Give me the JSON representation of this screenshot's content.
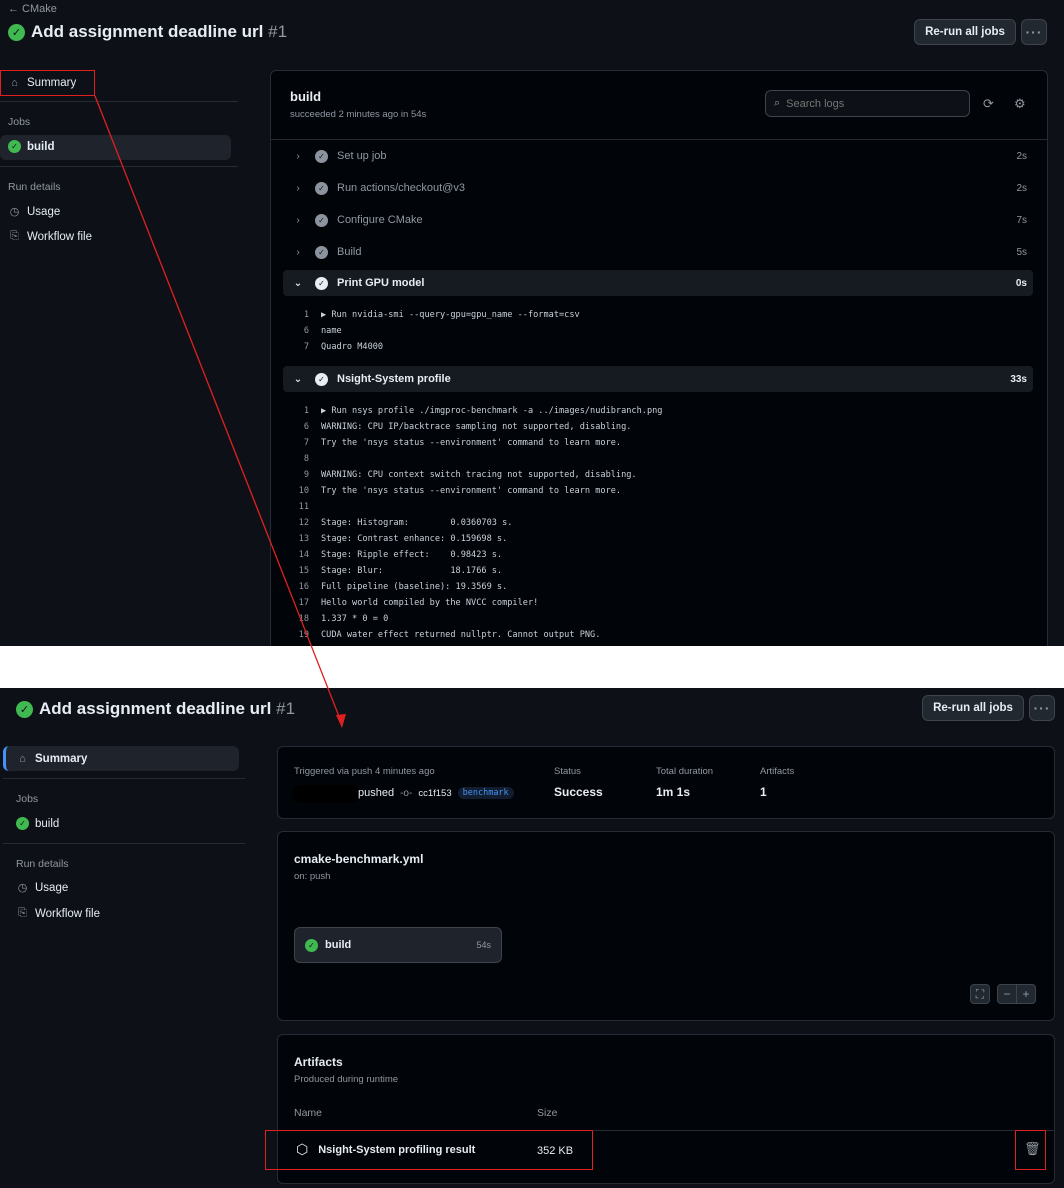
{
  "top": {
    "back_label": "← CMake",
    "title": "Add assignment deadline url",
    "run_number": "#1",
    "rerun_label": "Re-run all jobs",
    "more_label": "···",
    "sidebar": {
      "summary": "Summary",
      "jobs_heading": "Jobs",
      "build": "build",
      "run_details_heading": "Run details",
      "usage": "Usage",
      "workflow_file": "Workflow file"
    },
    "log": {
      "title": "build",
      "subtitle": "succeeded 2 minutes ago in 54s",
      "search_placeholder": "Search logs",
      "steps": [
        {
          "name": "Set up job",
          "duration": "2s"
        },
        {
          "name": "Run actions/checkout@v3",
          "duration": "2s"
        },
        {
          "name": "Configure CMake",
          "duration": "7s"
        },
        {
          "name": "Build",
          "duration": "5s"
        }
      ],
      "gpu_step": {
        "name": "Print GPU model",
        "duration": "0s"
      },
      "gpu_lines": [
        {
          "n": "1",
          "t": "▶ Run nvidia-smi --query-gpu=gpu_name --format=csv"
        },
        {
          "n": "6",
          "t": "name"
        },
        {
          "n": "7",
          "t": "Quadro M4000"
        }
      ],
      "nsight_step": {
        "name": "Nsight-System profile",
        "duration": "33s"
      },
      "nsight_lines": [
        {
          "n": "1",
          "t": "▶ Run nsys profile ./imgproc-benchmark -a ../images/nudibranch.png"
        },
        {
          "n": "6",
          "t": "WARNING: CPU IP/backtrace sampling not supported, disabling."
        },
        {
          "n": "7",
          "t": "Try the 'nsys status --environment' command to learn more."
        },
        {
          "n": "8",
          "t": ""
        },
        {
          "n": "9",
          "t": "WARNING: CPU context switch tracing not supported, disabling."
        },
        {
          "n": "10",
          "t": "Try the 'nsys status --environment' command to learn more."
        },
        {
          "n": "11",
          "t": ""
        },
        {
          "n": "12",
          "t": "Stage: Histogram:        0.0360703 s."
        },
        {
          "n": "13",
          "t": "Stage: Contrast enhance: 0.159698 s."
        },
        {
          "n": "14",
          "t": "Stage: Ripple effect:    0.98423 s."
        },
        {
          "n": "15",
          "t": "Stage: Blur:             18.1766 s."
        },
        {
          "n": "16",
          "t": "Full pipeline (baseline): 19.3569 s."
        },
        {
          "n": "17",
          "t": "Hello world compiled by the NVCC compiler!"
        },
        {
          "n": "18",
          "t": "1.337 * 0 = 0"
        },
        {
          "n": "19",
          "t": "CUDA water effect returned nullptr. Cannot output PNG."
        }
      ]
    }
  },
  "bottom": {
    "title": "Add assignment deadline url",
    "run_number": "#1",
    "rerun_label": "Re-run all jobs",
    "more_label": "···",
    "sidebar": {
      "summary": "Summary",
      "jobs_heading": "Jobs",
      "build": "build",
      "run_details_heading": "Run details",
      "usage": "Usage",
      "workflow_file": "Workflow file"
    },
    "summary_card": {
      "triggered": "Triggered via push 4 minutes ago",
      "pushed": "pushed",
      "commit": "cc1f153",
      "branch": "benchmark",
      "status_label": "Status",
      "status_value": "Success",
      "duration_label": "Total duration",
      "duration_value": "1m 1s",
      "artifacts_label": "Artifacts",
      "artifacts_value": "1"
    },
    "workflow_card": {
      "file": "cmake-benchmark.yml",
      "trigger": "on: push",
      "job_name": "build",
      "job_duration": "54s",
      "zoom_out": "−",
      "zoom_in": "+"
    },
    "artifacts_card": {
      "title": "Artifacts",
      "subtitle": "Produced during runtime",
      "col_name": "Name",
      "col_size": "Size",
      "artifact_name": "Nsight-System profiling result",
      "artifact_size": "352 KB"
    }
  },
  "colors": {
    "bg": "#0d1117",
    "panel": "#010409",
    "success": "#3fb950",
    "annotation": "#e02020",
    "link": "#4493f8"
  }
}
